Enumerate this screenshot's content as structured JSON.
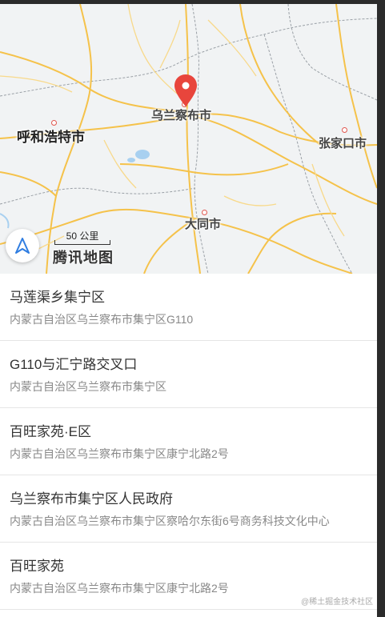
{
  "map": {
    "cities": {
      "wulanchabu": "乌兰察布市",
      "hohhot": "呼和浩特市",
      "zhangjiakou": "张家口市",
      "datong": "大同市"
    },
    "scale_label": "50 公里",
    "brand": "腾讯地图",
    "pin_color": "#e8453c",
    "road_color": "#f5c24a",
    "water_color": "#a8d0f0"
  },
  "results": [
    {
      "title": "马莲渠乡集宁区",
      "address": "内蒙古自治区乌兰察布市集宁区G110"
    },
    {
      "title": "G110与汇宁路交叉口",
      "address": "内蒙古自治区乌兰察布市集宁区"
    },
    {
      "title": "百旺家苑·E区",
      "address": "内蒙古自治区乌兰察布市集宁区康宁北路2号"
    },
    {
      "title": "乌兰察布市集宁区人民政府",
      "address": "内蒙古自治区乌兰察布市集宁区察哈尔东街6号商务科技文化中心"
    },
    {
      "title": "百旺家苑",
      "address": "内蒙古自治区乌兰察布市集宁区康宁北路2号"
    }
  ],
  "watermark": "@稀土掘金技术社区"
}
